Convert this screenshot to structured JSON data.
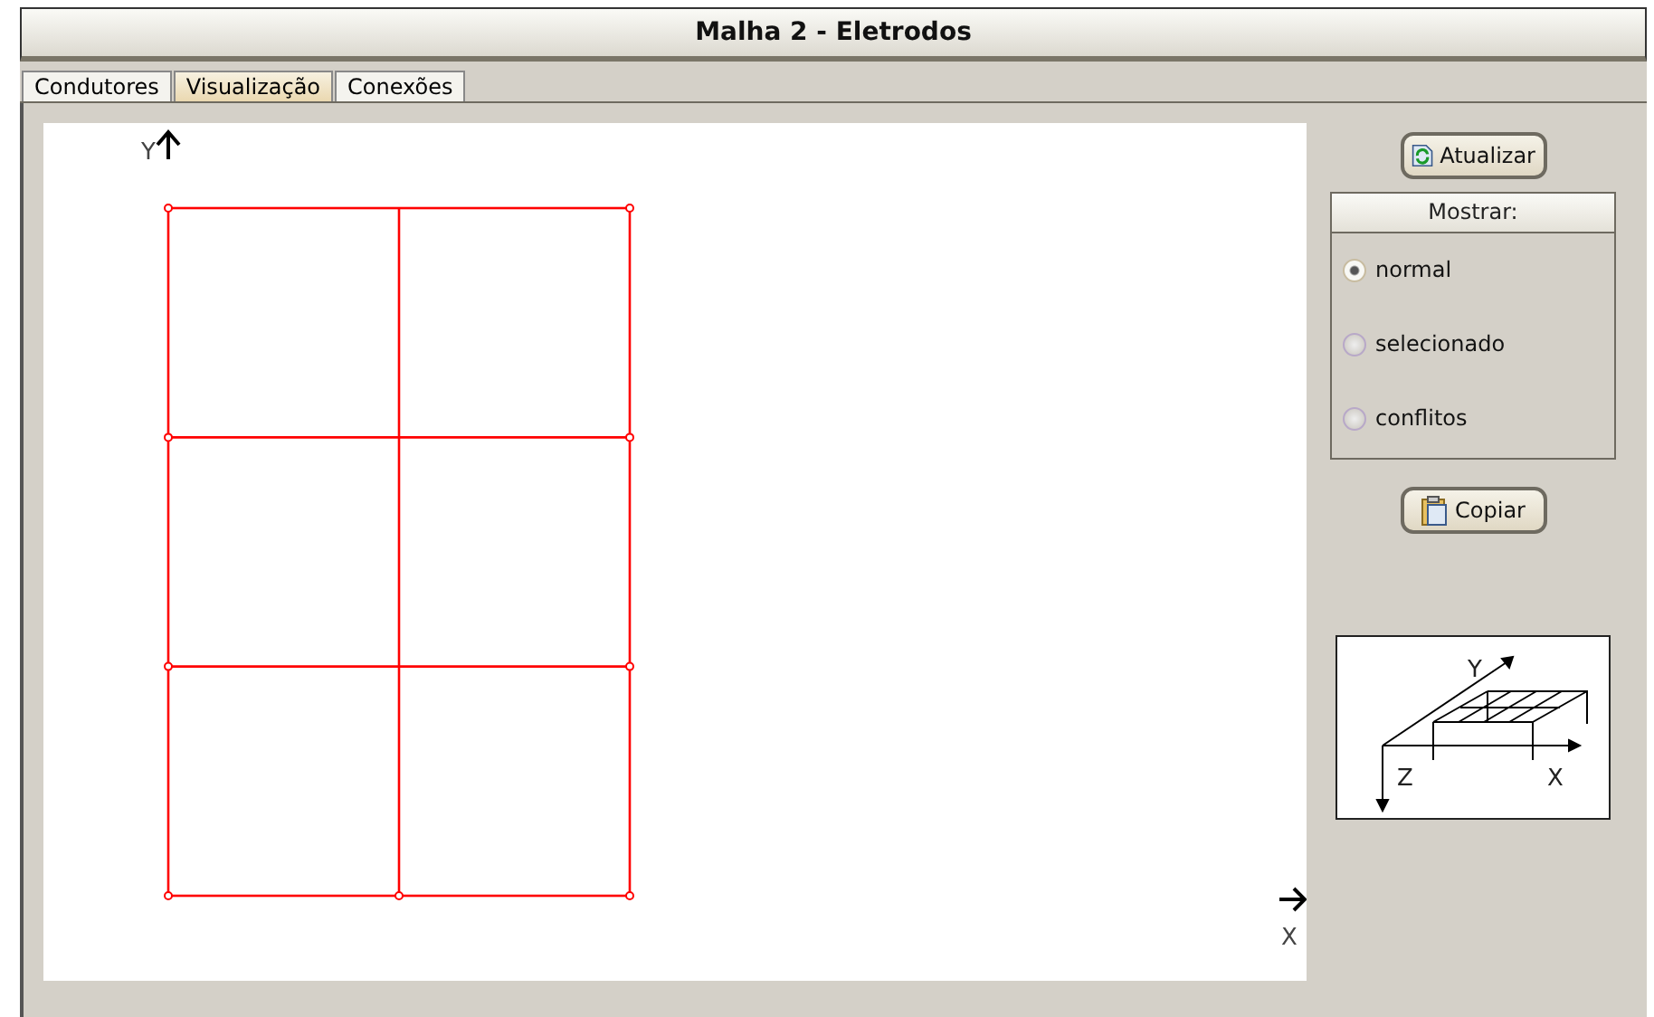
{
  "window": {
    "title": "Malha 2 - Eletrodos"
  },
  "tabs": [
    {
      "label": "Condutores",
      "selected": false
    },
    {
      "label": "Visualização",
      "selected": true
    },
    {
      "label": "Conexões",
      "selected": false
    }
  ],
  "canvas": {
    "y_axis_label": "Y",
    "x_axis_label": "X"
  },
  "side_panel": {
    "refresh_button": "Atualizar",
    "show_group": {
      "title": "Mostrar:",
      "options": [
        {
          "label": "normal",
          "selected": true
        },
        {
          "label": "selecionado",
          "selected": false
        },
        {
          "label": "conflitos",
          "selected": false
        }
      ]
    },
    "copy_button": "Copiar",
    "axes_legend": {
      "y_label": "Y",
      "z_label": "Z",
      "x_label": "X"
    }
  }
}
